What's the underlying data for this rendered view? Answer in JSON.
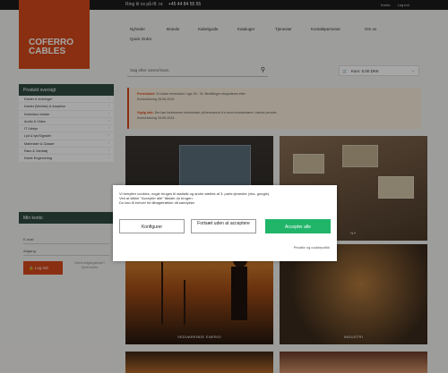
{
  "topbar": {
    "phone_label": "Ring til os på tlf. nr.",
    "phone_number": "+45 44 84 55 55",
    "account_link": "Konto",
    "login_link": "Log ind"
  },
  "logo": {
    "line1": "COFERRO",
    "line2": "CABLES"
  },
  "nav": {
    "items": [
      "Nyheder",
      "Brands",
      "Kabelguide",
      "Kataloger",
      "Tjenester",
      "Kontaktpersoner",
      "Om os",
      "Quick Order"
    ]
  },
  "search": {
    "placeholder": "Søg efter varenr/navn",
    "icon": "search-icon"
  },
  "cart": {
    "label": "Kurv: ",
    "amount": "0,00 DKK",
    "icon": "cart-icon"
  },
  "categories": {
    "header": "Produkt oversigt",
    "items": [
      "Kabler & ledninger",
      "Kabler (Metrisk) & Ampbinn",
      "Kabelsko/-holder",
      "Audio & Video",
      "IT Udstyr",
      "Lyd & lys/Signaler",
      "Materialer & Gasser",
      "Rørs & Værktøj",
      "Kable Engineering"
    ]
  },
  "account": {
    "header": "Min konto",
    "email_label": "E-mail",
    "password_label": "Adgang",
    "login_button": "Log ind",
    "forgot_line1": "Glemt adgangskode?",
    "forgot_line2": "Opret konto"
  },
  "notices": {
    "n1_title": "Ferielukket:",
    "n1_text": "Vi holder ferielukket i uge 28 - 30. Bestillinger ekspederes efter",
    "n1_date": "Kontorlukning 28-06-2024",
    "n2_title": "Vigtig info:",
    "n2_text": "Der kan forekomme forsinkelser på leverancer fra vores leverandører i denne periode.",
    "n2_date": "Kontorlukning 28-06-2024"
  },
  "tiles": [
    {
      "label": ""
    },
    {
      "label": "NY"
    },
    {
      "label": "VEDVARENDE ENERGI"
    },
    {
      "label": "INDUSTRI"
    },
    {
      "label": ""
    },
    {
      "label": ""
    }
  ],
  "cookie": {
    "line1": "Vi benytter cookies, nogle bruges til statistik og andre sættes af 3. parts tjenester (eks. google).",
    "line2": "Ved at klikke \"Accepter alle\" tillader du brugen.",
    "line3": "Du kan til enhver tid tilbagetrække dit samtykke.",
    "configure": "Konfigurer",
    "necessary": "Fortsæt uden at acceptere",
    "accept_all": "Accepter alle",
    "policy": "Privatliv og cookiepolitik"
  },
  "colors": {
    "accent": "#d4491b",
    "panel_header": "#2e4a40",
    "accept": "#21b56a",
    "topbar": "#1d1b1c"
  }
}
